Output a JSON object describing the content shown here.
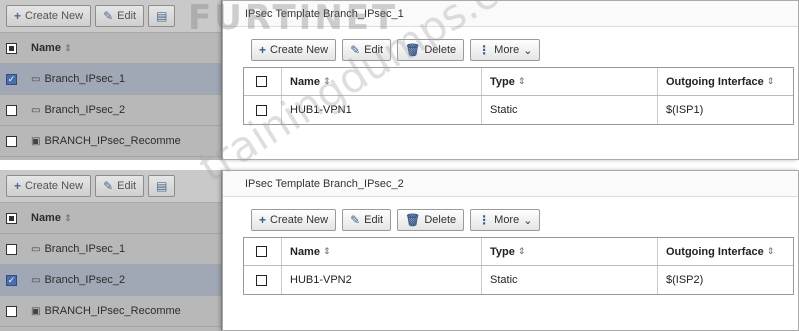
{
  "watermark": {
    "logo": "FURTINET",
    "site": "trainingdumps.com"
  },
  "panels": [
    {
      "bg": {
        "buttons": {
          "create": "Create New",
          "edit": "Edit"
        },
        "header": "Name",
        "rows": [
          {
            "label": "Branch_IPsec_1",
            "checked": true
          },
          {
            "label": "Branch_IPsec_2",
            "checked": false
          },
          {
            "label": "BRANCH_IPsec_Recomme",
            "checked": false
          }
        ]
      },
      "dialog": {
        "title": "IPsec Template Branch_IPsec_1",
        "toolbar": {
          "create": "Create New",
          "edit": "Edit",
          "delete": "Delete",
          "more": "More"
        },
        "columns": {
          "name": "Name",
          "type": "Type",
          "out": "Outgoing Interface"
        },
        "rows": [
          {
            "name": "HUB1-VPN1",
            "type": "Static",
            "out": "$(ISP1)"
          }
        ]
      }
    },
    {
      "bg": {
        "buttons": {
          "create": "Create New",
          "edit": "Edit"
        },
        "header": "Name",
        "rows": [
          {
            "label": "Branch_IPsec_1",
            "checked": false
          },
          {
            "label": "Branch_IPsec_2",
            "checked": true
          },
          {
            "label": "BRANCH_IPsec_Recomme",
            "checked": false
          }
        ]
      },
      "dialog": {
        "title": "IPsec Template Branch_IPsec_2",
        "toolbar": {
          "create": "Create New",
          "edit": "Edit",
          "delete": "Delete",
          "more": "More"
        },
        "columns": {
          "name": "Name",
          "type": "Type",
          "out": "Outgoing Interface"
        },
        "rows": [
          {
            "name": "HUB1-VPN2",
            "type": "Static",
            "out": "$(ISP2)"
          }
        ]
      }
    }
  ]
}
